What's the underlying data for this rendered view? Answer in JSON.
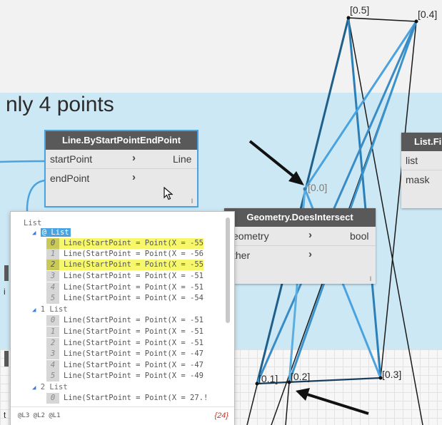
{
  "group": {
    "title": "nly 4 points"
  },
  "nodes": {
    "line_by_start_end": {
      "title": "Line.ByStartPointEndPoint",
      "inputs": [
        "startPoint",
        "endPoint"
      ],
      "output": "Line",
      "footer": "l"
    },
    "does_intersect": {
      "title": "Geometry.DoesIntersect",
      "inputs": [
        "eometry",
        "ther"
      ],
      "output": "bool",
      "footer": "l"
    },
    "list_filter": {
      "title": "List.Fi",
      "inputs": [
        "list",
        "mask"
      ]
    }
  },
  "points": {
    "p00": "[0.0]",
    "p01": "[0.1]",
    "p02": "[0.2]",
    "p03": "[0.3]",
    "p04": "[0.4]",
    "p05": "[0.5]"
  },
  "side_labels": {
    "left_i": "i",
    "left_t": "t"
  },
  "watch": {
    "root": "List",
    "groups": [
      {
        "header": "@ List",
        "selected": true,
        "items": [
          {
            "idx": "0",
            "text": "Line(StartPoint = Point(X = -55",
            "highlight": true
          },
          {
            "idx": "1",
            "text": "Line(StartPoint = Point(X = -56",
            "highlight": false
          },
          {
            "idx": "2",
            "text": "Line(StartPoint = Point(X = -55",
            "highlight": true
          },
          {
            "idx": "3",
            "text": "Line(StartPoint = Point(X = -51",
            "highlight": false
          },
          {
            "idx": "4",
            "text": "Line(StartPoint = Point(X = -51",
            "highlight": false
          },
          {
            "idx": "5",
            "text": "Line(StartPoint = Point(X = -54",
            "highlight": false
          }
        ]
      },
      {
        "header": "1 List",
        "selected": false,
        "items": [
          {
            "idx": "0",
            "text": "Line(StartPoint = Point(X = -51",
            "highlight": false
          },
          {
            "idx": "1",
            "text": "Line(StartPoint = Point(X = -51",
            "highlight": false
          },
          {
            "idx": "2",
            "text": "Line(StartPoint = Point(X = -51",
            "highlight": false
          },
          {
            "idx": "3",
            "text": "Line(StartPoint = Point(X = -47",
            "highlight": false
          },
          {
            "idx": "4",
            "text": "Line(StartPoint = Point(X = -47",
            "highlight": false
          },
          {
            "idx": "5",
            "text": "Line(StartPoint = Point(X = -49",
            "highlight": false
          }
        ]
      },
      {
        "header": "2 List",
        "selected": false,
        "items": [
          {
            "idx": "0",
            "text": "Line(StartPoint = Point(X = 27.!",
            "highlight": false
          }
        ]
      }
    ],
    "levels": "@L3 @L2 @L1",
    "count": "{24}"
  },
  "icons": {
    "annotation_arrows": "arrow-icon",
    "cursor": "mouse-pointer-icon",
    "expand": "caret-down-icon"
  },
  "colors": {
    "canvas_band": "#cde8f5",
    "node_header": "#595959",
    "highlight": "#f7f76b",
    "selection": "#4aa3df",
    "count_text": "#c0392b"
  }
}
